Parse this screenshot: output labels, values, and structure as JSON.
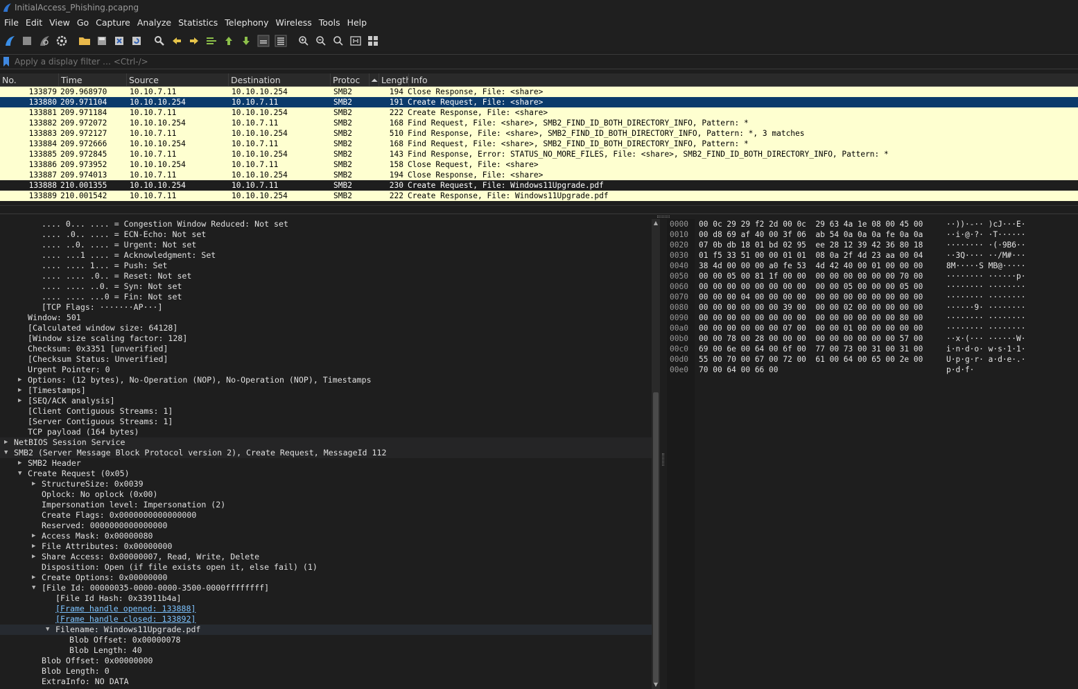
{
  "window": {
    "title": "InitialAccess_Phishing.pcapng"
  },
  "menu": [
    "File",
    "Edit",
    "View",
    "Go",
    "Capture",
    "Analyze",
    "Statistics",
    "Telephony",
    "Wireless",
    "Tools",
    "Help"
  ],
  "toolbar": {
    "icons": [
      "shark-fin-start-icon",
      "stop-square-icon",
      "restart-fin-icon",
      "capture-options-gear-icon",
      "open-folder-icon",
      "save-file-icon",
      "close-file-icon",
      "reload-file-icon",
      "find-packet-icon",
      "go-back-arrow-icon",
      "go-forward-arrow-icon",
      "go-to-packet-icon",
      "go-first-packet-icon",
      "go-last-packet-icon",
      "autoscroll-icon",
      "colorize-icon",
      "zoom-in-icon",
      "zoom-out-icon",
      "zoom-normal-icon",
      "resize-columns-icon",
      "layout-icon"
    ]
  },
  "filter": {
    "placeholder": "Apply a display filter … <Ctrl-/>"
  },
  "packet_list": {
    "columns": [
      "No.",
      "Time",
      "Source",
      "Destination",
      "Protoc",
      "Length",
      "Info"
    ],
    "rows": [
      {
        "no": "133879",
        "time": "209.968970",
        "src": "10.10.7.11",
        "dst": "10.10.10.254",
        "proto": "SMB2",
        "len": "194",
        "info": "Close Response, File: <share>",
        "state": "normal"
      },
      {
        "no": "133880",
        "time": "209.971104",
        "src": "10.10.10.254",
        "dst": "10.10.7.11",
        "proto": "SMB2",
        "len": "191",
        "info": "Create Request, File: <share>",
        "state": "selected"
      },
      {
        "no": "133881",
        "time": "209.971184",
        "src": "10.10.7.11",
        "dst": "10.10.10.254",
        "proto": "SMB2",
        "len": "222",
        "info": "Create Response, File: <share>",
        "state": "normal"
      },
      {
        "no": "133882",
        "time": "209.972072",
        "src": "10.10.10.254",
        "dst": "10.10.7.11",
        "proto": "SMB2",
        "len": "168",
        "info": "Find Request, File: <share>, SMB2_FIND_ID_BOTH_DIRECTORY_INFO, Pattern: *",
        "state": "normal"
      },
      {
        "no": "133883",
        "time": "209.972127",
        "src": "10.10.7.11",
        "dst": "10.10.10.254",
        "proto": "SMB2",
        "len": "510",
        "info": "Find Response, File: <share>, SMB2_FIND_ID_BOTH_DIRECTORY_INFO, Pattern: *, 3 matches",
        "state": "normal"
      },
      {
        "no": "133884",
        "time": "209.972666",
        "src": "10.10.10.254",
        "dst": "10.10.7.11",
        "proto": "SMB2",
        "len": "168",
        "info": "Find Request, File: <share>, SMB2_FIND_ID_BOTH_DIRECTORY_INFO, Pattern: *",
        "state": "normal"
      },
      {
        "no": "133885",
        "time": "209.972845",
        "src": "10.10.7.11",
        "dst": "10.10.10.254",
        "proto": "SMB2",
        "len": "143",
        "info": "Find Response, Error: STATUS_NO_MORE_FILES, File: <share>, SMB2_FIND_ID_BOTH_DIRECTORY_INFO, Pattern: *",
        "state": "normal"
      },
      {
        "no": "133886",
        "time": "209.973952",
        "src": "10.10.10.254",
        "dst": "10.10.7.11",
        "proto": "SMB2",
        "len": "158",
        "info": "Close Request, File: <share>",
        "state": "normal"
      },
      {
        "no": "133887",
        "time": "209.974013",
        "src": "10.10.7.11",
        "dst": "10.10.10.254",
        "proto": "SMB2",
        "len": "194",
        "info": "Close Response, File: <share>",
        "state": "normal"
      },
      {
        "no": "133888",
        "time": "210.001355",
        "src": "10.10.10.254",
        "dst": "10.10.7.11",
        "proto": "SMB2",
        "len": "230",
        "info": "Create Request, File: Windows11Upgrade.pdf",
        "state": "dark"
      },
      {
        "no": "133889",
        "time": "210.001542",
        "src": "10.10.7.11",
        "dst": "10.10.10.254",
        "proto": "SMB2",
        "len": "222",
        "info": "Create Response, File: Windows11Upgrade.pdf",
        "state": "normal"
      }
    ]
  },
  "details": [
    {
      "indent": 3,
      "text": ".... 0... .... = Congestion Window Reduced: Not set"
    },
    {
      "indent": 3,
      "text": ".... .0.. .... = ECN-Echo: Not set"
    },
    {
      "indent": 3,
      "text": ".... ..0. .... = Urgent: Not set"
    },
    {
      "indent": 3,
      "text": ".... ...1 .... = Acknowledgment: Set"
    },
    {
      "indent": 3,
      "text": ".... .... 1... = Push: Set"
    },
    {
      "indent": 3,
      "text": ".... .... .0.. = Reset: Not set"
    },
    {
      "indent": 3,
      "text": ".... .... ..0. = Syn: Not set"
    },
    {
      "indent": 3,
      "text": ".... .... ...0 = Fin: Not set"
    },
    {
      "indent": 3,
      "text": "[TCP Flags: ·······AP···]"
    },
    {
      "indent": 2,
      "text": "Window: 501"
    },
    {
      "indent": 2,
      "text": "[Calculated window size: 64128]"
    },
    {
      "indent": 2,
      "text": "[Window size scaling factor: 128]"
    },
    {
      "indent": 2,
      "text": "Checksum: 0x3351 [unverified]"
    },
    {
      "indent": 2,
      "text": "[Checksum Status: Unverified]"
    },
    {
      "indent": 2,
      "text": "Urgent Pointer: 0"
    },
    {
      "indent": 2,
      "text": "Options: (12 bytes), No-Operation (NOP), No-Operation (NOP), Timestamps",
      "arrow": "collapsed"
    },
    {
      "indent": 2,
      "text": "[Timestamps]",
      "arrow": "collapsed"
    },
    {
      "indent": 2,
      "text": "[SEQ/ACK analysis]",
      "arrow": "collapsed"
    },
    {
      "indent": 2,
      "text": "[Client Contiguous Streams: 1]"
    },
    {
      "indent": 2,
      "text": "[Server Contiguous Streams: 1]"
    },
    {
      "indent": 2,
      "text": "TCP payload (164 bytes)"
    },
    {
      "indent": 1,
      "text": "NetBIOS Session Service",
      "arrow": "collapsed",
      "section": true
    },
    {
      "indent": 1,
      "text": "SMB2 (Server Message Block Protocol version 2), Create Request, MessageId 112",
      "arrow": "expanded",
      "section": true
    },
    {
      "indent": 2,
      "text": "SMB2 Header",
      "arrow": "collapsed"
    },
    {
      "indent": 2,
      "text": "Create Request (0x05)",
      "arrow": "expanded"
    },
    {
      "indent": 3,
      "text": "StructureSize: 0x0039",
      "arrow": "collapsed"
    },
    {
      "indent": 3,
      "text": "Oplock: No oplock (0x00)"
    },
    {
      "indent": 3,
      "text": "Impersonation level: Impersonation (2)"
    },
    {
      "indent": 3,
      "text": "Create Flags: 0x0000000000000000"
    },
    {
      "indent": 3,
      "text": "Reserved: 0000000000000000"
    },
    {
      "indent": 3,
      "text": "Access Mask: 0x00000080",
      "arrow": "collapsed"
    },
    {
      "indent": 3,
      "text": "File Attributes: 0x00000000",
      "arrow": "collapsed"
    },
    {
      "indent": 3,
      "text": "Share Access: 0x00000007, Read, Write, Delete",
      "arrow": "collapsed"
    },
    {
      "indent": 3,
      "text": "Disposition: Open (if file exists open it, else fail) (1)"
    },
    {
      "indent": 3,
      "text": "Create Options: 0x00000000",
      "arrow": "collapsed"
    },
    {
      "indent": 3,
      "text": "[File Id: 00000035-0000-0000-3500-0000ffffffff]",
      "arrow": "expanded"
    },
    {
      "indent": 4,
      "text": "[File Id Hash: 0x33911b4a]"
    },
    {
      "indent": 4,
      "text": "[Frame handle opened: 133888]",
      "link": true
    },
    {
      "indent": 4,
      "text": "[Frame handle closed: 133892]",
      "link": true
    },
    {
      "indent": 4,
      "text": "Filename: Windows11Upgrade.pdf",
      "arrow": "expanded",
      "selected": true
    },
    {
      "indent": 5,
      "text": "Blob Offset: 0x00000078"
    },
    {
      "indent": 5,
      "text": "Blob Length: 40"
    },
    {
      "indent": 3,
      "text": "Blob Offset: 0x00000000"
    },
    {
      "indent": 3,
      "text": "Blob Length: 0"
    },
    {
      "indent": 3,
      "text": "ExtraInfo: NO DATA"
    }
  ],
  "hex": {
    "offsets": [
      "0000",
      "0010",
      "0020",
      "0030",
      "0040",
      "0050",
      "0060",
      "0070",
      "0080",
      "0090",
      "00a0",
      "00b0",
      "00c0",
      "00d0",
      "00e0"
    ],
    "bytes": [
      "00 0c 29 29 f2 2d 00 0c  29 63 4a 1e 08 00 45 00",
      "00 d8 69 af 40 00 3f 06  ab 54 0a 0a 0a fe 0a 0a",
      "07 0b db 18 01 bd 02 95  ee 28 12 39 42 36 80 18",
      "01 f5 33 51 00 00 01 01  08 0a 2f 4d 23 aa 00 04",
      "38 4d 00 00 00 a0 fe 53  4d 42 40 00 01 00 00 00",
      "00 00 05 00 81 1f 00 00  00 00 00 00 00 00 70 00",
      "00 00 00 00 00 00 00 00  00 00 05 00 00 00 05 00",
      "00 00 00 04 00 00 00 00  00 00 00 00 00 00 00 00",
      "00 00 00 00 00 00 39 00  00 00 02 00 00 00 00 00",
      "00 00 00 00 00 00 00 00  00 00 00 00 00 00 80 00",
      "00 00 00 00 00 00 07 00  00 00 01 00 00 00 00 00",
      "00 00 78 00 28 00 00 00  00 00 00 00 00 00 57 00",
      "69 00 6e 00 64 00 6f 00  77 00 73 00 31 00 31 00",
      "55 00 70 00 67 00 72 00  61 00 64 00 65 00 2e 00",
      "70 00 64 00 66 00"
    ],
    "ascii": [
      "··))·-·· )cJ···E·",
      "··i·@·?· ·T······",
      "········ ·(·9B6··",
      "··3Q···· ··/M#···",
      "8M·····S MB@·····",
      "········ ······p·",
      "········ ········",
      "········ ········",
      "······9· ········",
      "········ ········",
      "········ ········",
      "··x·(··· ······W·",
      "i·n·d·o· w·s·1·1·",
      "U·p·g·r· a·d·e·.·",
      "p·d·f·"
    ]
  }
}
